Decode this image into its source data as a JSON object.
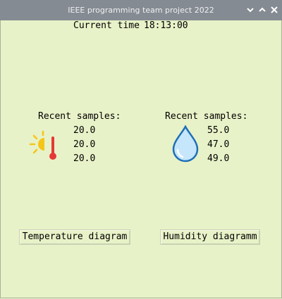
{
  "window": {
    "title": "IEEE programming team project 2022",
    "controls": [
      "close-icon",
      "maximize-icon",
      "minimize-icon"
    ]
  },
  "clock": {
    "label": "Current time",
    "value": "18:13:00"
  },
  "temperature": {
    "heading": "Recent samples:",
    "icon": "sun-thermometer-icon",
    "samples": [
      "20.0",
      "20.0",
      "20.0"
    ],
    "button_label": "Temperature diagram"
  },
  "humidity": {
    "heading": "Recent samples:",
    "icon": "water-drop-icon",
    "samples": [
      "55.0",
      "47.0",
      "49.0"
    ],
    "button_label": "Humidity diagramm"
  },
  "colors": {
    "background": "#e8f2c8",
    "titlebar": "#858b92",
    "sun": "#f5c518",
    "thermometer": "#e53935",
    "drop_fill": "#c6e6fb",
    "drop_stroke": "#1e6fb8"
  }
}
